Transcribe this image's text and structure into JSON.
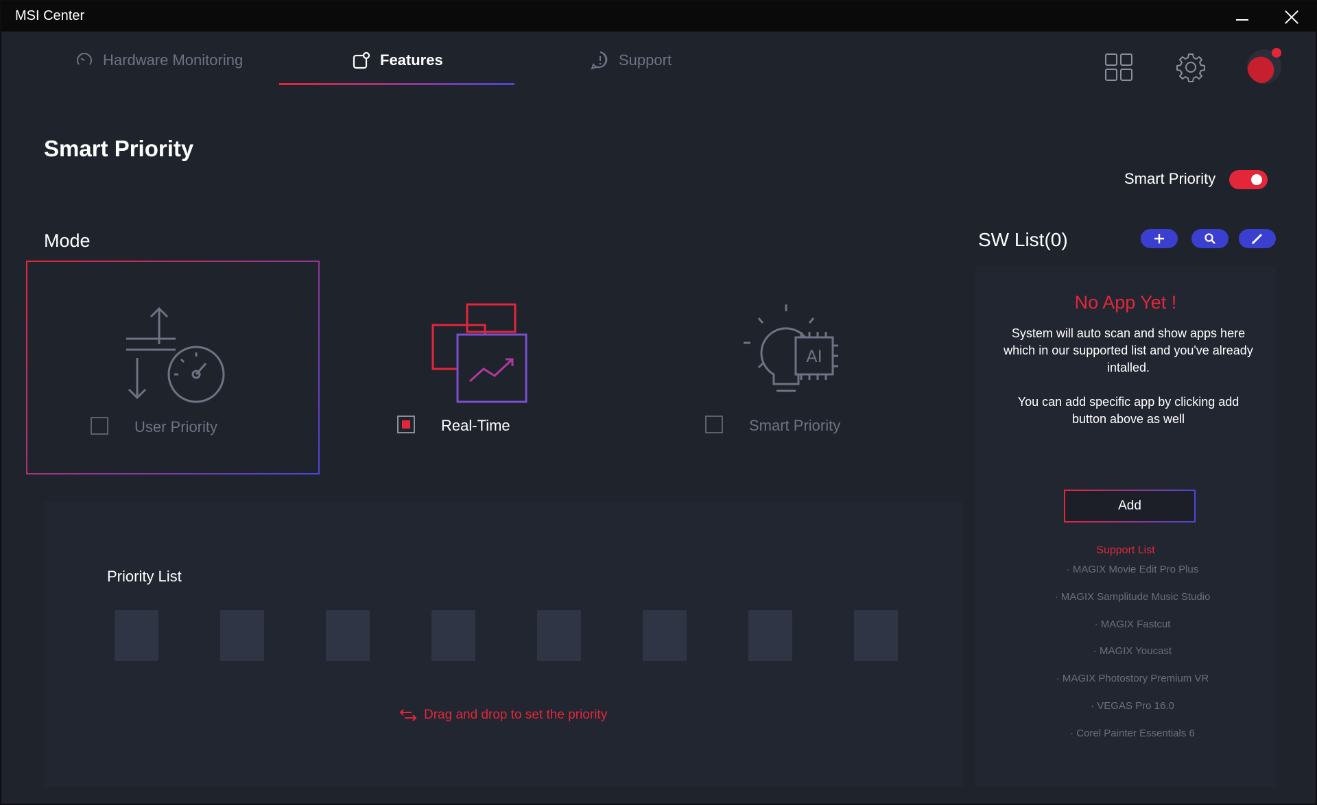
{
  "window": {
    "title": "MSI Center"
  },
  "tabs": [
    {
      "label": "Hardware Monitoring",
      "active": false,
      "icon": "gauge-icon"
    },
    {
      "label": "Features",
      "active": true,
      "icon": "features-icon"
    },
    {
      "label": "Support",
      "active": false,
      "icon": "support-icon"
    }
  ],
  "header_icons": [
    "apps-grid-icon",
    "gear-icon",
    "avatar"
  ],
  "page": {
    "title": "Smart Priority"
  },
  "smart_priority_toggle": {
    "label": "Smart Priority",
    "on": true
  },
  "mode": {
    "label": "Mode",
    "options": [
      {
        "label": "User Priority",
        "checked": false,
        "selected": true,
        "icon": "user-priority-icon"
      },
      {
        "label": "Real-Time",
        "checked": true,
        "selected": false,
        "icon": "real-time-icon"
      },
      {
        "label": "Smart Priority",
        "checked": false,
        "selected": false,
        "icon": "ai-bulb-icon"
      }
    ]
  },
  "priority_list": {
    "title": "Priority List",
    "slot_count": 8,
    "hint": "Drag and drop to set the priority"
  },
  "sw_list": {
    "title": "SW List(0)",
    "buttons": [
      "plus-icon",
      "search-icon",
      "edit-icon"
    ],
    "empty_title": "No App Yet !",
    "message1": "System will auto scan and show apps here which in our supported list and you've already intalled.",
    "message2": "You can add specific app by clicking add button above as well",
    "add_label": "Add",
    "support_title": "Support List",
    "support_items": [
      "· MAGIX Movie Edit Pro Plus",
      "· MAGIX Samplitude Music Studio",
      "· MAGIX Fastcut",
      "· MAGIX Youcast",
      "· MAGIX Photostory Premium VR",
      "· VEGAS Pro 16.0",
      "· Corel Painter Essentials 6"
    ]
  },
  "colors": {
    "accent_red": "#e3263a",
    "accent_blue": "#3b3fd0",
    "background": "#1f232c"
  }
}
